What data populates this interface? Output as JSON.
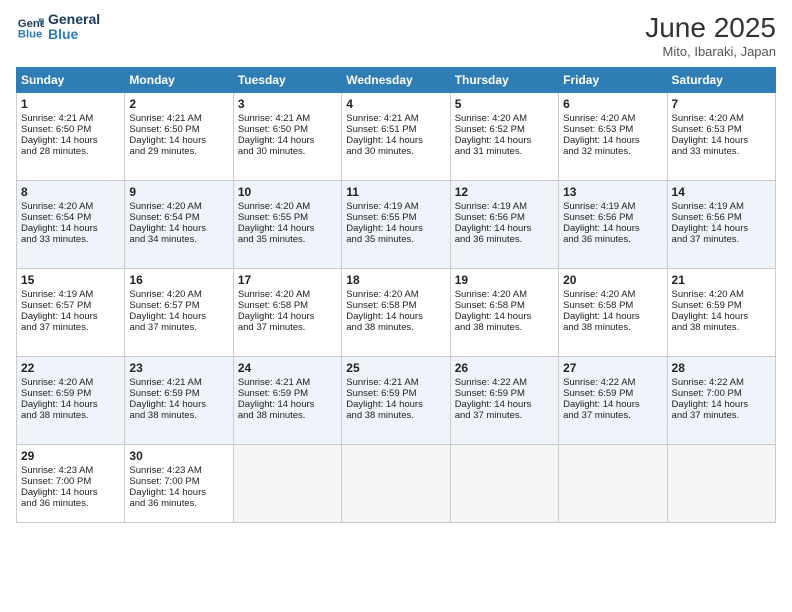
{
  "header": {
    "logo_line1": "General",
    "logo_line2": "Blue",
    "title": "June 2025",
    "location": "Mito, Ibaraki, Japan"
  },
  "days_of_week": [
    "Sunday",
    "Monday",
    "Tuesday",
    "Wednesday",
    "Thursday",
    "Friday",
    "Saturday"
  ],
  "weeks": [
    [
      {
        "day": "1",
        "lines": [
          "Sunrise: 4:21 AM",
          "Sunset: 6:50 PM",
          "Daylight: 14 hours",
          "and 28 minutes."
        ]
      },
      {
        "day": "2",
        "lines": [
          "Sunrise: 4:21 AM",
          "Sunset: 6:50 PM",
          "Daylight: 14 hours",
          "and 29 minutes."
        ]
      },
      {
        "day": "3",
        "lines": [
          "Sunrise: 4:21 AM",
          "Sunset: 6:50 PM",
          "Daylight: 14 hours",
          "and 30 minutes."
        ]
      },
      {
        "day": "4",
        "lines": [
          "Sunrise: 4:21 AM",
          "Sunset: 6:51 PM",
          "Daylight: 14 hours",
          "and 30 minutes."
        ]
      },
      {
        "day": "5",
        "lines": [
          "Sunrise: 4:20 AM",
          "Sunset: 6:52 PM",
          "Daylight: 14 hours",
          "and 31 minutes."
        ]
      },
      {
        "day": "6",
        "lines": [
          "Sunrise: 4:20 AM",
          "Sunset: 6:53 PM",
          "Daylight: 14 hours",
          "and 32 minutes."
        ]
      },
      {
        "day": "7",
        "lines": [
          "Sunrise: 4:20 AM",
          "Sunset: 6:53 PM",
          "Daylight: 14 hours",
          "and 33 minutes."
        ]
      }
    ],
    [
      {
        "day": "8",
        "lines": [
          "Sunrise: 4:20 AM",
          "Sunset: 6:54 PM",
          "Daylight: 14 hours",
          "and 33 minutes."
        ]
      },
      {
        "day": "9",
        "lines": [
          "Sunrise: 4:20 AM",
          "Sunset: 6:54 PM",
          "Daylight: 14 hours",
          "and 34 minutes."
        ]
      },
      {
        "day": "10",
        "lines": [
          "Sunrise: 4:20 AM",
          "Sunset: 6:55 PM",
          "Daylight: 14 hours",
          "and 35 minutes."
        ]
      },
      {
        "day": "11",
        "lines": [
          "Sunrise: 4:19 AM",
          "Sunset: 6:55 PM",
          "Daylight: 14 hours",
          "and 35 minutes."
        ]
      },
      {
        "day": "12",
        "lines": [
          "Sunrise: 4:19 AM",
          "Sunset: 6:56 PM",
          "Daylight: 14 hours",
          "and 36 minutes."
        ]
      },
      {
        "day": "13",
        "lines": [
          "Sunrise: 4:19 AM",
          "Sunset: 6:56 PM",
          "Daylight: 14 hours",
          "and 36 minutes."
        ]
      },
      {
        "day": "14",
        "lines": [
          "Sunrise: 4:19 AM",
          "Sunset: 6:56 PM",
          "Daylight: 14 hours",
          "and 37 minutes."
        ]
      }
    ],
    [
      {
        "day": "15",
        "lines": [
          "Sunrise: 4:19 AM",
          "Sunset: 6:57 PM",
          "Daylight: 14 hours",
          "and 37 minutes."
        ]
      },
      {
        "day": "16",
        "lines": [
          "Sunrise: 4:20 AM",
          "Sunset: 6:57 PM",
          "Daylight: 14 hours",
          "and 37 minutes."
        ]
      },
      {
        "day": "17",
        "lines": [
          "Sunrise: 4:20 AM",
          "Sunset: 6:58 PM",
          "Daylight: 14 hours",
          "and 37 minutes."
        ]
      },
      {
        "day": "18",
        "lines": [
          "Sunrise: 4:20 AM",
          "Sunset: 6:58 PM",
          "Daylight: 14 hours",
          "and 38 minutes."
        ]
      },
      {
        "day": "19",
        "lines": [
          "Sunrise: 4:20 AM",
          "Sunset: 6:58 PM",
          "Daylight: 14 hours",
          "and 38 minutes."
        ]
      },
      {
        "day": "20",
        "lines": [
          "Sunrise: 4:20 AM",
          "Sunset: 6:58 PM",
          "Daylight: 14 hours",
          "and 38 minutes."
        ]
      },
      {
        "day": "21",
        "lines": [
          "Sunrise: 4:20 AM",
          "Sunset: 6:59 PM",
          "Daylight: 14 hours",
          "and 38 minutes."
        ]
      }
    ],
    [
      {
        "day": "22",
        "lines": [
          "Sunrise: 4:20 AM",
          "Sunset: 6:59 PM",
          "Daylight: 14 hours",
          "and 38 minutes."
        ]
      },
      {
        "day": "23",
        "lines": [
          "Sunrise: 4:21 AM",
          "Sunset: 6:59 PM",
          "Daylight: 14 hours",
          "and 38 minutes."
        ]
      },
      {
        "day": "24",
        "lines": [
          "Sunrise: 4:21 AM",
          "Sunset: 6:59 PM",
          "Daylight: 14 hours",
          "and 38 minutes."
        ]
      },
      {
        "day": "25",
        "lines": [
          "Sunrise: 4:21 AM",
          "Sunset: 6:59 PM",
          "Daylight: 14 hours",
          "and 38 minutes."
        ]
      },
      {
        "day": "26",
        "lines": [
          "Sunrise: 4:22 AM",
          "Sunset: 6:59 PM",
          "Daylight: 14 hours",
          "and 37 minutes."
        ]
      },
      {
        "day": "27",
        "lines": [
          "Sunrise: 4:22 AM",
          "Sunset: 6:59 PM",
          "Daylight: 14 hours",
          "and 37 minutes."
        ]
      },
      {
        "day": "28",
        "lines": [
          "Sunrise: 4:22 AM",
          "Sunset: 7:00 PM",
          "Daylight: 14 hours",
          "and 37 minutes."
        ]
      }
    ],
    [
      {
        "day": "29",
        "lines": [
          "Sunrise: 4:23 AM",
          "Sunset: 7:00 PM",
          "Daylight: 14 hours",
          "and 36 minutes."
        ]
      },
      {
        "day": "30",
        "lines": [
          "Sunrise: 4:23 AM",
          "Sunset: 7:00 PM",
          "Daylight: 14 hours",
          "and 36 minutes."
        ]
      },
      {
        "day": "",
        "lines": []
      },
      {
        "day": "",
        "lines": []
      },
      {
        "day": "",
        "lines": []
      },
      {
        "day": "",
        "lines": []
      },
      {
        "day": "",
        "lines": []
      }
    ]
  ]
}
